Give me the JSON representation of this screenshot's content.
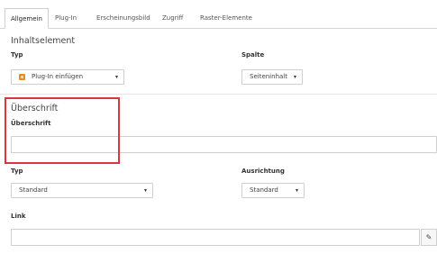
{
  "tabs": [
    {
      "label": "Allgemein",
      "active": true
    },
    {
      "label": "Plug-In",
      "active": false
    },
    {
      "label": "Erscheinungsbild",
      "active": false
    },
    {
      "label": "Zugriff",
      "active": false
    },
    {
      "label": "Raster-Elemente",
      "active": false
    }
  ],
  "content_element": {
    "section_title": "Inhaltselement",
    "type_label": "Typ",
    "type_value": "Plug-In einfügen",
    "column_label": "Spalte",
    "column_value": "Seiteninhalt"
  },
  "header": {
    "section_title": "Überschrift",
    "field_label": "Überschrift",
    "field_value": "",
    "type_label": "Typ",
    "type_value": "Standard",
    "align_label": "Ausrichtung",
    "align_value": "Standard",
    "link_label": "Link",
    "link_value": ""
  },
  "colors": {
    "highlight": "#d9363e",
    "plugin_icon": "#e58c2a"
  },
  "icons": {
    "caret": "▾",
    "link_picker": "✎"
  }
}
